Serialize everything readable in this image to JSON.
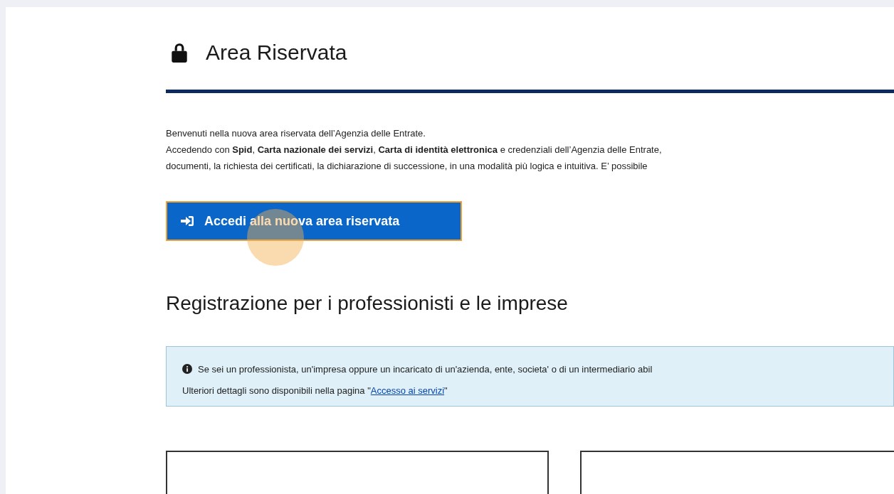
{
  "header": {
    "title": "Area Riservata"
  },
  "intro": [
    "Benvenuti nella nuova area riservata dell’Agenzia delle Entrate.",
    "Accedendo con **Spid**, **Carta nazionale dei servizi**, **Carta di identità elettronica** e credenziali dell’Agenzia delle Entrate,",
    "documenti, la richiesta dei certificati, la dichiarazione di successione, in una modalità più logica e intuitiva. E’ possibile"
  ],
  "login_button": {
    "label": "Accedi alla nuova area riservata"
  },
  "registration": {
    "heading": "Registrazione per i professionisti e le imprese",
    "info": {
      "text": "Se sei un professionista, un'impresa oppure un incaricato di un'azienda, ente, societa' o di un intermediario abil",
      "details": "Ulteriori dettagli sono disponibili nella pagina \"",
      "link": "Accesso ai servizi",
      "after": "\""
    }
  }
}
